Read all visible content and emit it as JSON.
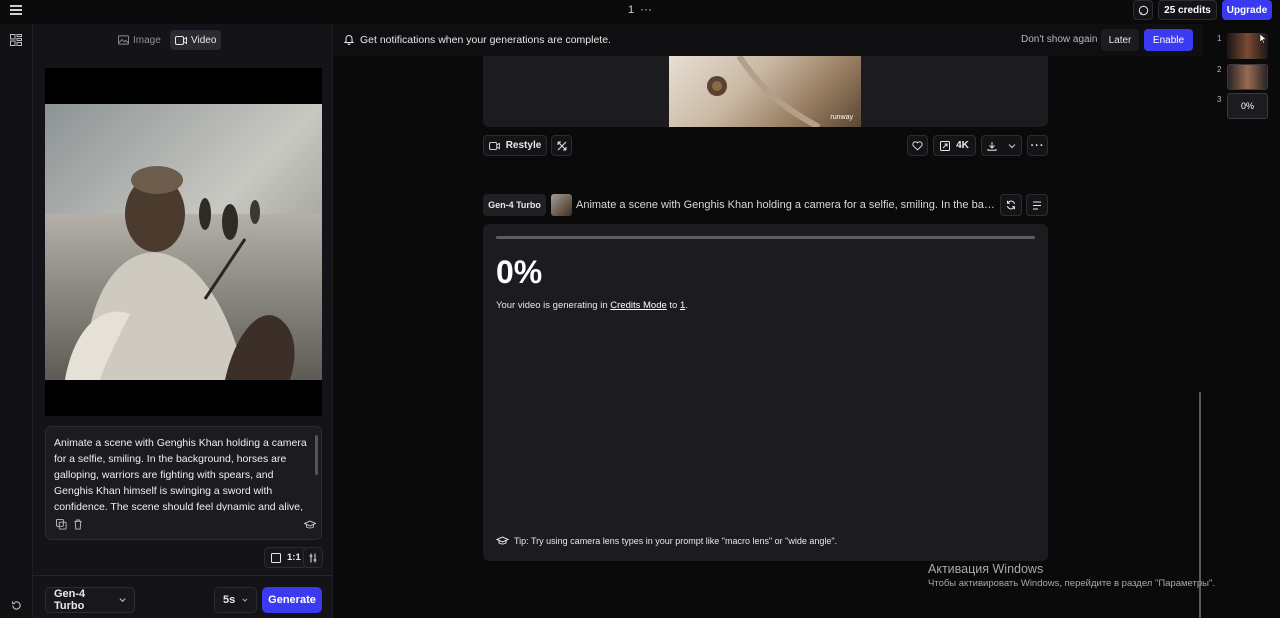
{
  "topbar": {
    "page_number": "1",
    "more": "···",
    "credits_label": "25 credits",
    "upgrade_label": "Upgrade"
  },
  "left_panel": {
    "tabs": [
      {
        "label": "Image",
        "active": false
      },
      {
        "label": "Video",
        "active": true
      }
    ],
    "prompt_text": "Animate a scene with Genghis Khan holding a camera for a selfie, smiling. In the background, horses are galloping, warriors are fighting with spears, and Genghis Khan himself is swinging a sword with confidence. The scene should feel dynamic and alive,",
    "aspect_ratio": "1:1",
    "model_label": "Gen-4 Turbo",
    "duration_label": "5s",
    "generate_label": "Generate"
  },
  "notification": {
    "text": "Get notifications when your generations are complete.",
    "dont_show_label": "Don't show again",
    "later_label": "Later",
    "enable_label": "Enable"
  },
  "previous_card": {
    "watermark": "runway",
    "restyle_label": "Restyle",
    "resolution_label": "4K"
  },
  "generation": {
    "model_badge": "Gen-4 Turbo",
    "prompt_preview": "Animate a scene with Genghis Khan holding a camera for a selfie, smiling. In the backgr...",
    "progress_percent": 0,
    "progress_label": "0%",
    "info_prefix": "Your video is generating in ",
    "info_mode": "Credits Mode",
    "info_mid": " to ",
    "info_target": "1",
    "info_suffix": ".",
    "tip": "Tip: Try using camera lens types in your prompt like \"macro lens\" or \"wide angle\"."
  },
  "thumbnails": [
    {
      "number": "1"
    },
    {
      "number": "2"
    },
    {
      "number": "3",
      "label": "0%"
    }
  ],
  "windows_activation": {
    "title": "Активация Windows",
    "subtitle": "Чтобы активировать Windows, перейдите в раздел \"Параметры\"."
  },
  "colors": {
    "accent": "#3a3af0",
    "background": "#0a0a0b",
    "panel": "#141418",
    "card": "#1b1b20"
  }
}
